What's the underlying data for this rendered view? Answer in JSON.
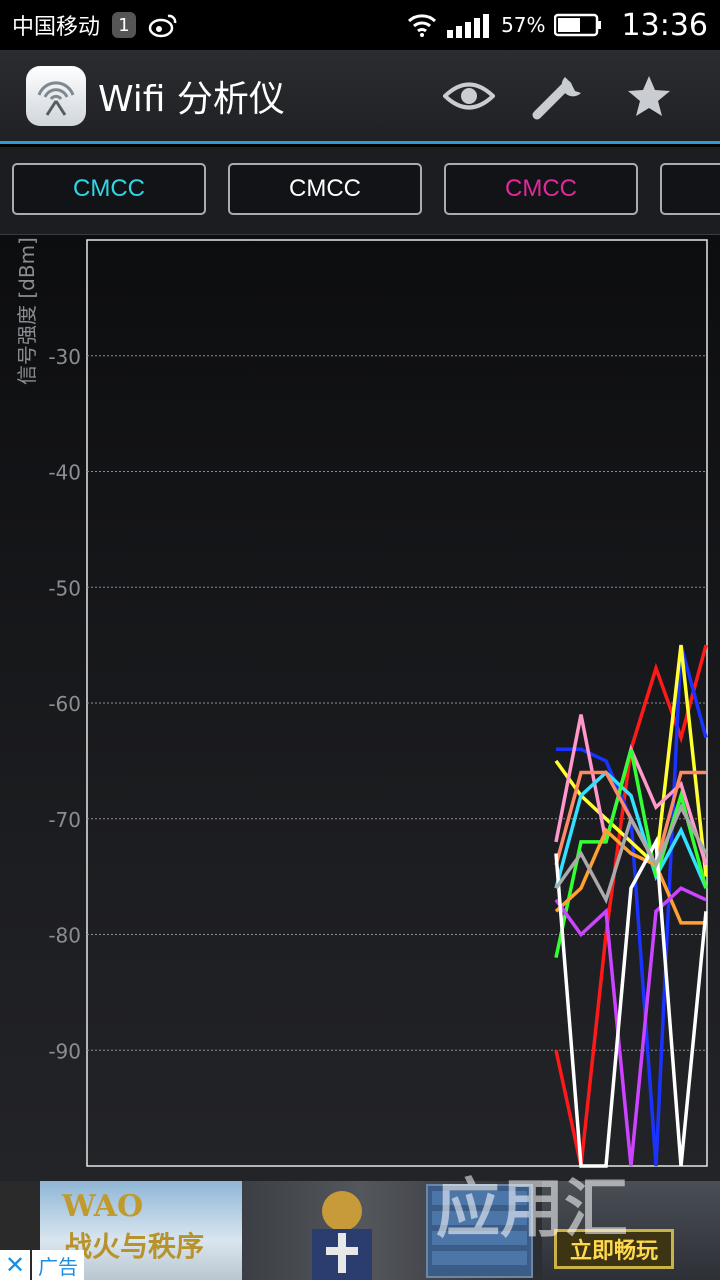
{
  "status_bar": {
    "carrier": "中国移动",
    "notification_count": "1",
    "battery_percent": "57%",
    "time": "13:36",
    "icons": [
      "weibo-icon",
      "wifi-icon",
      "signal-icon",
      "battery-icon"
    ]
  },
  "action_bar": {
    "title": "Wifi 分析仪",
    "icons": [
      "eye-icon",
      "wrench-icon",
      "star-icon"
    ]
  },
  "network_tabs": [
    {
      "label": "CMCC",
      "color": "#2fd6e8"
    },
    {
      "label": "CMCC",
      "color": "#ffffff"
    },
    {
      "label": "CMCC",
      "color": "#e0299a"
    },
    {
      "label": "",
      "color": "#ffffff"
    }
  ],
  "chart_data": {
    "type": "line",
    "ylabel": "信号强度 [dBm]",
    "xlabel": "",
    "ylim": [
      -100,
      -20
    ],
    "yticks": [
      -30,
      -40,
      -50,
      -60,
      -70,
      -80,
      -90
    ],
    "grid": true,
    "x": [
      0,
      1,
      2,
      3,
      4,
      5,
      6
    ],
    "series": [
      {
        "color": "#ff1a1a",
        "values": [
          -90,
          -100,
          -80,
          -64,
          -57,
          -63,
          -55
        ]
      },
      {
        "color": "#1a33ff",
        "values": [
          -64,
          -64,
          -65,
          -70,
          -100,
          -55,
          -63
        ]
      },
      {
        "color": "#ffff33",
        "values": [
          -65,
          -68,
          -70,
          -72,
          -74,
          -55,
          -75
        ]
      },
      {
        "color": "#ff99cc",
        "values": [
          -72,
          -61,
          -72,
          -64,
          -69,
          -67,
          -74
        ]
      },
      {
        "color": "#33e0ff",
        "values": [
          -76,
          -68,
          -66,
          -68,
          -75,
          -71,
          -76
        ]
      },
      {
        "color": "#33ff33",
        "values": [
          -82,
          -72,
          -72,
          -64,
          -75,
          -68,
          -76
        ]
      },
      {
        "color": "#ff8866",
        "values": [
          -74,
          -66,
          -66,
          -70,
          -74,
          -66,
          -66
        ]
      },
      {
        "color": "#ffa033",
        "values": [
          -78,
          -76,
          -71,
          -73,
          -74,
          -79,
          -79
        ]
      },
      {
        "color": "#cc44ff",
        "values": [
          -77,
          -80,
          -78,
          -100,
          -78,
          -76,
          -77
        ]
      },
      {
        "color": "#ffffff",
        "values": [
          -73,
          -100,
          -100,
          -76,
          -72,
          -100,
          -78
        ]
      },
      {
        "color": "#aaaaaa",
        "values": [
          -76,
          -73,
          -77,
          -70,
          -74,
          -69,
          -73
        ]
      }
    ]
  },
  "ad": {
    "game_title": "WAO",
    "game_subtitle": "战火与秩序",
    "cta": "立即畅玩",
    "label": "广告",
    "close": "✕",
    "watermark": "应用汇"
  }
}
